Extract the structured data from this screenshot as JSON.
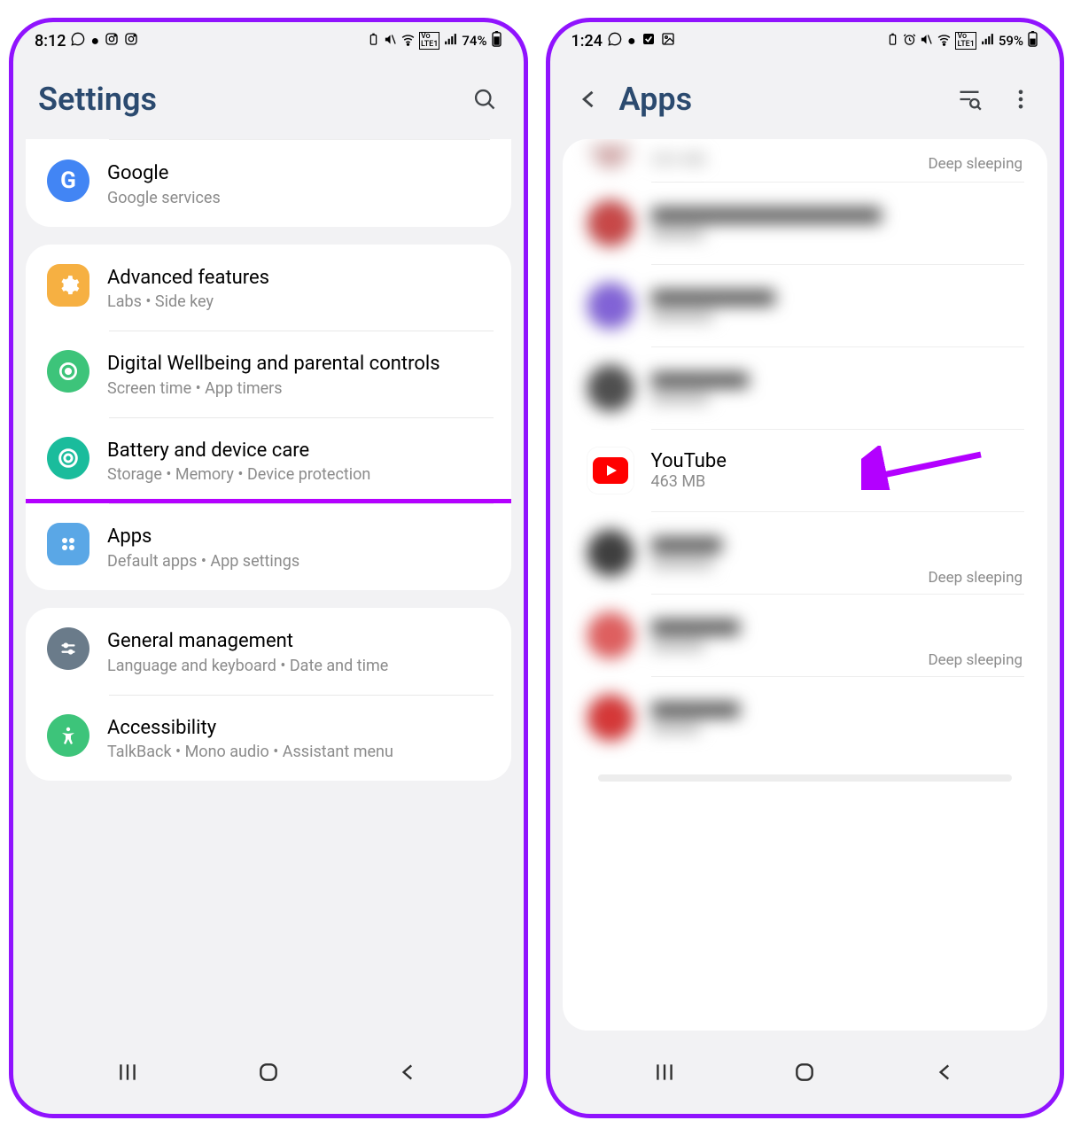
{
  "left": {
    "status": {
      "time": "8:12",
      "battery": "74%"
    },
    "title": "Settings",
    "groups": [
      {
        "items": [
          {
            "id": "google",
            "title": "Google",
            "sub": "Google services",
            "icon_bg": "#4285f4",
            "icon": "G"
          }
        ]
      },
      {
        "items": [
          {
            "id": "advanced",
            "title": "Advanced features",
            "sub": "Labs  •  Side key",
            "icon_bg": "#f6b042",
            "icon": "gear"
          },
          {
            "id": "wellbeing",
            "title": "Digital Wellbeing and parental controls",
            "sub": "Screen time  •  App timers",
            "icon_bg": "#3dc47a",
            "icon": "wellbeing"
          },
          {
            "id": "battery",
            "title": "Battery and device care",
            "sub": "Storage  •  Memory  •  Device protection",
            "icon_bg": "#1abc9c",
            "icon": "care"
          },
          {
            "id": "apps",
            "title": "Apps",
            "sub": "Default apps  •  App settings",
            "icon_bg": "#5aa7e6",
            "icon": "apps",
            "highlight": true
          }
        ]
      },
      {
        "items": [
          {
            "id": "general",
            "title": "General management",
            "sub": "Language and keyboard  •  Date and time",
            "icon_bg": "#6a7b8a",
            "icon": "sliders"
          },
          {
            "id": "accessibility",
            "title": "Accessibility",
            "sub": "TalkBack  •  Mono audio  •  Assistant menu",
            "icon_bg": "#3dc47a",
            "icon": "a11y"
          }
        ]
      }
    ]
  },
  "right": {
    "status": {
      "time": "1:24",
      "battery": "59%"
    },
    "title": "Apps",
    "partial_top_sub": "303 MB",
    "partial_top_badge": "Deep sleeping",
    "rows": [
      {
        "blurred": true,
        "icon_bg": "#d45050"
      },
      {
        "blurred": true,
        "icon_bg": "#8b6ae0"
      },
      {
        "blurred": true,
        "icon_bg": "#5a5a5a"
      },
      {
        "blurred": false,
        "title": "YouTube",
        "sub": "463 MB",
        "icon": "youtube"
      },
      {
        "blurred": true,
        "icon_bg": "#4a4a4a",
        "badge": "Deep sleeping"
      },
      {
        "blurred": true,
        "icon_bg": "#e66a6a",
        "badge": "Deep sleeping"
      },
      {
        "blurred": true,
        "icon_bg": "#e04040"
      }
    ]
  }
}
